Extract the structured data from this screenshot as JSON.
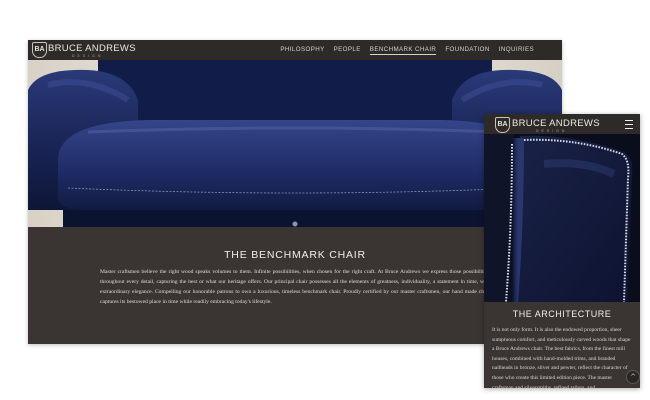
{
  "brand": {
    "monogram": "BA",
    "name": "BRUCE ANDREWS",
    "tagline": "DESIGN"
  },
  "desktop": {
    "nav": [
      "PHILOSOPHY",
      "PEOPLE",
      "BENCHMARK CHAIR",
      "FOUNDATION",
      "INQUIRIES"
    ],
    "active_nav": "BENCHMARK CHAIR",
    "title": "THE BENCHMARK CHAIR",
    "body": "Master craftsmen believe the right wood speaks volumes to them. Infinite possibilities, when chosen for the right craft. At Bruce Andrews we express those possibilities throughout every detail, capturing the best or what our heritage offers. Our principal chair possesses all the elements of greatness, individuality, a statement in time, with extraordinary elegance. Compelling our honorable patrons to own a luxurious, timeless benchmark chair. Proudly certified by our master craftsmen, our hand made chair captures its bestowed place in time while readily embracing today's lifestyle."
  },
  "mobile": {
    "menu_icon": "hamburger-icon",
    "title": "THE ARCHITECTURE",
    "body": "It is not only form. It is also the endowed proportion, sheer sumptuous comfort, and meticulously carved woods that shape a Bruce Andrews chair. The best fabrics, from the finest mill houses, combined with hand-molded trims, and branded nailheads in bronze, silver and pewter, reflect the character of those who create this limited edition piece. The master craftsman and silversmiths, refined tailors, and",
    "scroll_icon": "chevron-up-icon"
  },
  "colors": {
    "panel": "#3a3533",
    "nav": "#2e2a28",
    "velvet": "#1c2a5e"
  }
}
